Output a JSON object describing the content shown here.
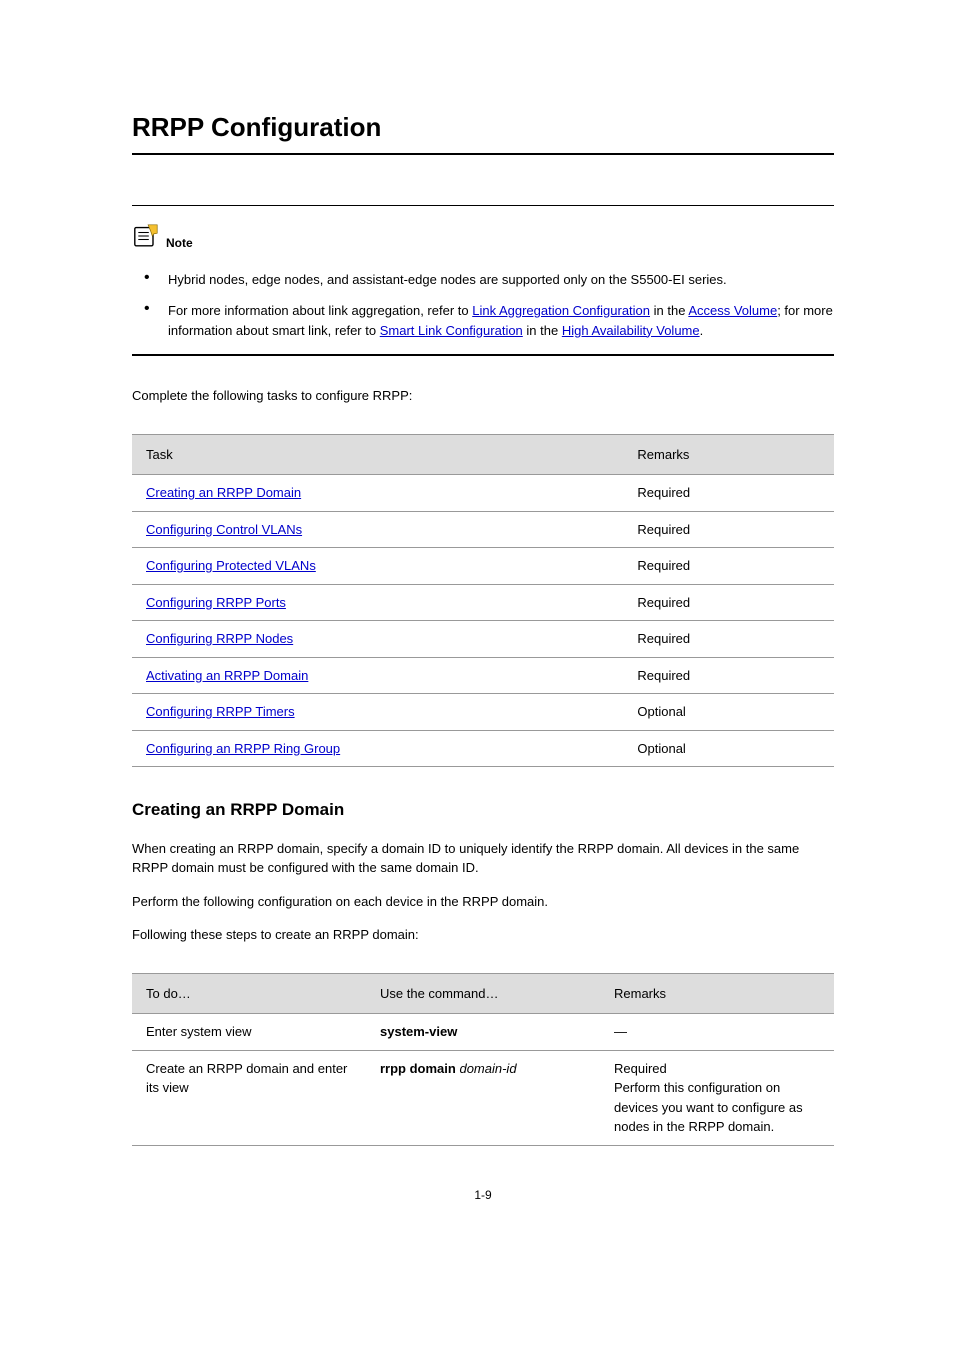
{
  "page_title": "RRPP Configuration",
  "note": {
    "label": "Note",
    "bullet1": "Hybrid nodes, edge nodes, and assistant-edge nodes are supported only on the S5500-EI series.",
    "b2_prefix": "For more information about link aggregation, refer to ",
    "b2_link1": "Link Aggregation Configuration",
    "b2_mid1": " in the ",
    "b2_link2": "Access Volume",
    "b2_mid2": "; for more information about smart link, refer to",
    "b2_mid3": " ",
    "b2_link3": "Smart Link Configuration",
    "b2_mid4": " in the ",
    "b2_link4": "High Availability Volume",
    "b2_tail": "."
  },
  "toc_header": "Complete the following tasks to configure RRPP:",
  "table1": {
    "caption": "",
    "col_task": "Task",
    "col_remarks": "Remarks",
    "rows": [
      {
        "task": "Creating an RRPP Domain",
        "remarks": "Required"
      },
      {
        "task": "Configuring Control VLANs",
        "remarks": "Required"
      },
      {
        "task": "Configuring Protected VLANs",
        "remarks": "Required"
      },
      {
        "task": "Configuring RRPP Ports",
        "remarks": "Required"
      },
      {
        "task": "Configuring RRPP Nodes",
        "remarks": "Required"
      },
      {
        "task": "Activating an RRPP Domain",
        "remarks": "Required"
      },
      {
        "task": "Configuring RRPP Timers",
        "remarks": "Optional"
      },
      {
        "task": "Configuring an RRPP Ring Group",
        "remarks": "Optional"
      }
    ]
  },
  "section2": {
    "heading": "Creating an RRPP Domain",
    "para": "When creating an RRPP domain, specify a domain ID to uniquely identify the RRPP domain. All devices in the same RRPP domain must be configured with the same domain ID.",
    "lead": "Perform the following configuration on each device in the RRPP domain.",
    "follow": "Following these steps to create an RRPP domain:"
  },
  "table2": {
    "col_todo": "To do…",
    "col_cmd": "Use the command…",
    "col_remarks": "Remarks",
    "rows": [
      {
        "todo": "Enter system view",
        "cmd": "system-view",
        "remarks": "—"
      },
      {
        "todo": "Create an RRPP domain and enter its view",
        "cmd": "rrpp domain domain-id",
        "remarks": "Required\nPerform this configuration on devices you want to configure as nodes in the RRPP domain."
      }
    ]
  },
  "page_number": "1-9"
}
